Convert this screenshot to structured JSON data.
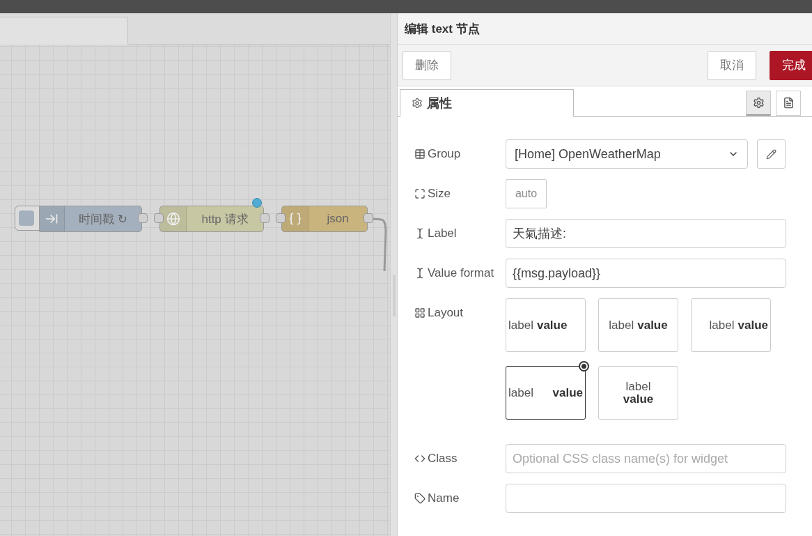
{
  "canvas": {
    "nodes": [
      {
        "kind": "inject",
        "label": "时间戳 ↻",
        "changed": false
      },
      {
        "kind": "http",
        "label": "http 请求",
        "changed": true
      },
      {
        "kind": "json",
        "label": "json",
        "changed": false
      }
    ]
  },
  "editor": {
    "title": "编辑 text 节点",
    "buttons": [
      {
        "kind": "delete",
        "label": "删除"
      },
      {
        "kind": "cancel",
        "label": "取消"
      },
      {
        "kind": "done",
        "label": "完成"
      }
    ],
    "tabs": [
      {
        "label": "属性",
        "selected": true
      }
    ],
    "tool_tabs": [
      {
        "kind": "settings",
        "selected": true
      },
      {
        "kind": "description",
        "selected": false
      }
    ],
    "rows": [
      {
        "kind": "select",
        "label": "Group",
        "value": "[Home] OpenWeatherMap"
      },
      {
        "kind": "size",
        "label": "Size",
        "value": "auto"
      },
      {
        "kind": "text",
        "label": "Label",
        "value": "天氣描述:"
      },
      {
        "kind": "text",
        "label": "Value format",
        "value": "{{msg.payload}}"
      },
      {
        "kind": "layout",
        "label": "Layout",
        "options": [
          {
            "kind": "left",
            "label": "label",
            "value": "value",
            "selected": false
          },
          {
            "kind": "center",
            "label": "label",
            "value": "value",
            "selected": false
          },
          {
            "kind": "right",
            "label": "label",
            "value": "value",
            "selected": false
          },
          {
            "kind": "spread",
            "label": "label",
            "value": "value",
            "selected": true
          },
          {
            "kind": "stacked",
            "label": "label",
            "value": "value",
            "selected": false
          }
        ]
      },
      {
        "kind": "text",
        "label": "Class",
        "placeholder": "Optional CSS class name(s) for widget"
      },
      {
        "kind": "text",
        "label": "Name"
      }
    ]
  }
}
